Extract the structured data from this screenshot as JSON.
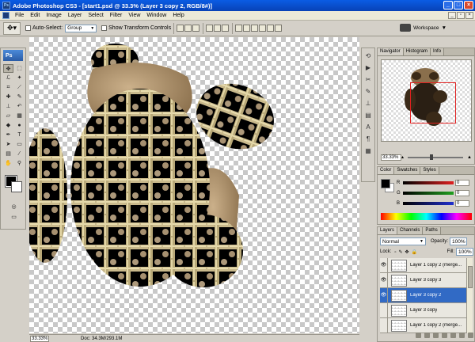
{
  "window": {
    "title": "Adobe Photoshop CS3 - [start1.psd @ 33.3% (Layer 3 copy 2, RGB/8#)]"
  },
  "menu": [
    "File",
    "Edit",
    "Image",
    "Layer",
    "Select",
    "Filter",
    "View",
    "Window",
    "Help"
  ],
  "options": {
    "auto_select_label": "Auto-Select:",
    "auto_select_value": "Group",
    "transform_label": "Show Transform Controls",
    "workspace_label": "Workspace"
  },
  "toolbox": {
    "logo": "Ps",
    "tools": [
      "move-tool",
      "marquee-tool",
      "lasso-tool",
      "magic-wand-tool",
      "crop-tool",
      "slice-tool",
      "healing-brush-tool",
      "brush-tool",
      "clone-stamp-tool",
      "history-brush-tool",
      "eraser-tool",
      "gradient-tool",
      "blur-tool",
      "dodge-tool",
      "pen-tool",
      "type-tool",
      "path-selection-tool",
      "shape-tool",
      "notes-tool",
      "eyedropper-tool",
      "hand-tool",
      "zoom-tool"
    ]
  },
  "status": {
    "zoom": "33.33%",
    "doc": "Doc: 34.3M/293.1M"
  },
  "navigator": {
    "tabs": [
      "Navigator",
      "Histogram",
      "Info"
    ],
    "zoom": "33.33%"
  },
  "color_panel": {
    "tabs": [
      "Color",
      "Swatches",
      "Styles"
    ],
    "channels": [
      {
        "label": "R",
        "value": "0",
        "color": "#e02020"
      },
      {
        "label": "G",
        "value": "0",
        "color": "#20a020"
      },
      {
        "label": "B",
        "value": "0",
        "color": "#2030d0"
      }
    ]
  },
  "layers_panel": {
    "tabs": [
      "Layers",
      "Channels",
      "Paths"
    ],
    "blend_mode": "Normal",
    "opacity_label": "Opacity:",
    "opacity": "100%",
    "lock_label": "Lock:",
    "fill_label": "Fill:",
    "fill": "100%",
    "layers": [
      {
        "name": "Layer 1 copy 2 (merge...",
        "visible": true,
        "selected": false
      },
      {
        "name": "Layer 3 copy 3",
        "visible": true,
        "selected": false
      },
      {
        "name": "Layer 3 copy 2",
        "visible": true,
        "selected": true
      },
      {
        "name": "Layer 3 copy",
        "visible": false,
        "selected": false
      },
      {
        "name": "Layer 1 copy 2 (merge...",
        "visible": false,
        "selected": false
      }
    ]
  },
  "accent_color": "#316ac5"
}
